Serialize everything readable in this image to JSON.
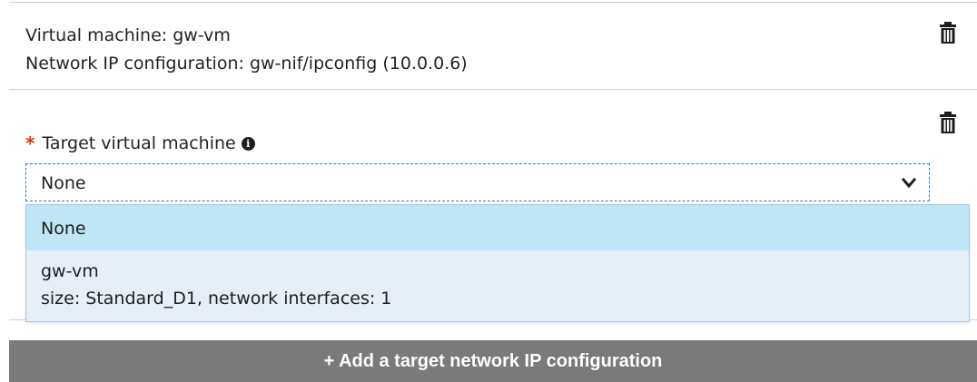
{
  "existing_config": {
    "vm_line": "Virtual machine: gw-vm",
    "ip_line": "Network IP configuration: gw-nif/ipconfig (10.0.0.6)",
    "delete_icon": "trash-icon"
  },
  "target_section": {
    "required_marker": "*",
    "label": "Target virtual machine",
    "info_icon": "info-icon",
    "info_glyph": "i",
    "delete_icon": "trash-icon",
    "select": {
      "value": "None",
      "chevron_icon": "chevron-down-icon",
      "options": [
        {
          "label": "None",
          "selected": true
        },
        {
          "label": "gw-vm",
          "detail": "size: Standard_D1, network interfaces: 1",
          "selected": false
        }
      ]
    }
  },
  "add_button": {
    "label": "+ Add a target network IP configuration"
  },
  "colors": {
    "required": "#d83b01",
    "selected_option_bg": "#bfe6f5",
    "dropdown_bg": "#e6eef8",
    "button_bg": "#7a7a7a",
    "select_border": "#3a78b8"
  }
}
